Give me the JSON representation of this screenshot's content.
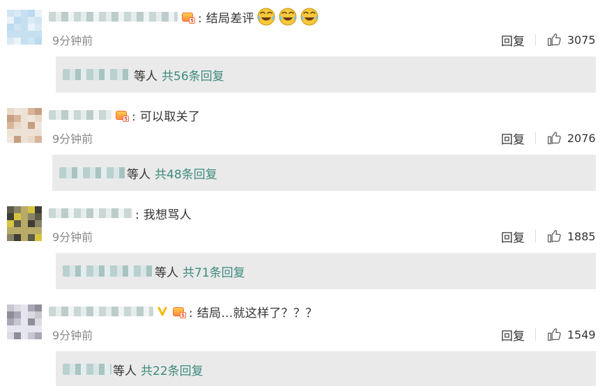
{
  "comments": [
    {
      "text": ": 结局差评",
      "time": "9分钟前",
      "reply_label": "回复",
      "likes": "3075",
      "has_vip": false,
      "emoji_count": 3,
      "replies_suffix": "等人",
      "replies_total": "共56条回复",
      "avatar_colors": [
        "#cfe5f2",
        "#bcdaf0",
        "#d9eaf5",
        "#eaf3f9",
        "#c6e0f1"
      ]
    },
    {
      "text": ": 可以取关了",
      "time": "9分钟前",
      "reply_label": "回复",
      "likes": "2076",
      "has_vip": false,
      "emoji_count": 0,
      "replies_suffix": "等人",
      "replies_total": "共48条回复",
      "avatar_colors": [
        "#e9d9c9",
        "#d8b59a",
        "#f1e6dc",
        "#c79f82",
        "#ede2d6"
      ]
    },
    {
      "text": ": 我想骂人",
      "time": "9分钟前",
      "reply_label": "回复",
      "likes": "1885",
      "has_vip": false,
      "emoji_count": 0,
      "replies_suffix": "等人",
      "replies_total": "共71条回复",
      "avatar_colors": [
        "#5e5a48",
        "#d6c441",
        "#8a8368",
        "#3f3d33",
        "#b8ab68"
      ]
    },
    {
      "text": ": 结局...就这样了？？？",
      "time": "9分钟前",
      "reply_label": "回复",
      "likes": "1549",
      "has_vip": true,
      "emoji_count": 0,
      "replies_suffix": "等人",
      "replies_total": "共22条回复",
      "avatar_colors": [
        "#c8c6cf",
        "#a9a6b5",
        "#dcdae2",
        "#8f8d99",
        "#e5e6f0"
      ]
    }
  ],
  "colors": {
    "accent_green": "#3d8a7c",
    "reply_box_bg": "#eaeaea",
    "time_gray": "#888888"
  },
  "icons": {
    "like": "thumbs-up-icon",
    "badge": "crown-level-badge-icon",
    "vip": "vip-v-icon",
    "emoji": "crying-laughing-emoji-icon"
  }
}
